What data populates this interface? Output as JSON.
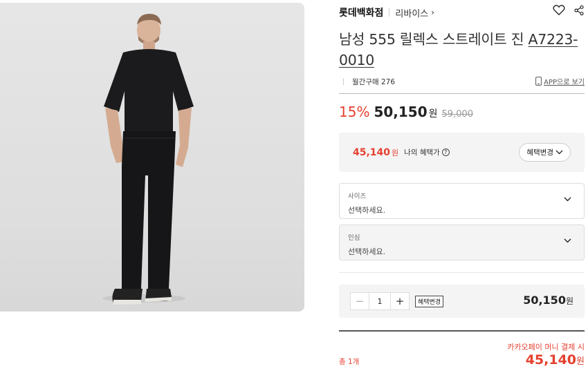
{
  "header": {
    "store": "롯데백화점",
    "brand": "리바이스",
    "brand_chevron": "›",
    "icons": [
      "heart-icon",
      "share-icon"
    ]
  },
  "product": {
    "title_main": "남성 555 릴렉스 스트레이트 진 ",
    "title_code": "A7223-0010",
    "monthly_sales": "월간구매 276",
    "app_view": "APP으로 보기",
    "image_alt": "man wearing black t-shirt and black straight jeans"
  },
  "price": {
    "discount": "15%",
    "sale": "50,150",
    "won": "원",
    "original": "59,000"
  },
  "benefit": {
    "price": "45,140",
    "won": "원",
    "label": "나의 혜택가",
    "info": "?",
    "button": "혜택변경"
  },
  "options": [
    {
      "label": "사이즈",
      "value": "선택하세요."
    },
    {
      "label": "인심",
      "value": "선택하세요."
    }
  ],
  "quantity": {
    "minus": "−",
    "value": "1",
    "plus": "+",
    "benefit_button": "혜택변경",
    "price": "50,150",
    "won": "원"
  },
  "total": {
    "kakao_note": "카카오페이 머니 결제 시",
    "count": "총 1개",
    "price": "45,140",
    "won": "원"
  },
  "colors": {
    "accent_red": "#e5402f",
    "panel_gray": "#f4f4f4"
  }
}
